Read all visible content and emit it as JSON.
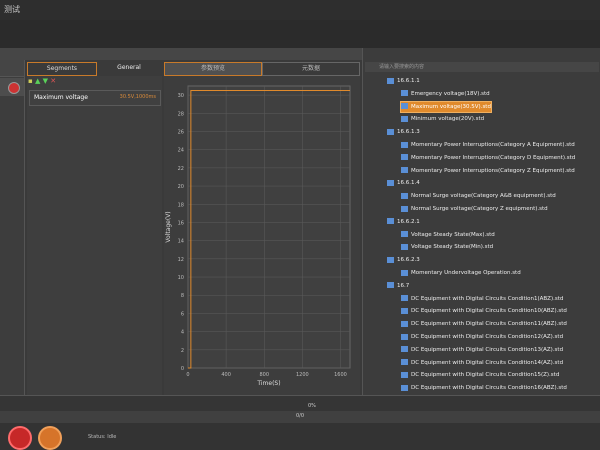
{
  "app": {
    "title": "测试"
  },
  "tabs": {
    "segments": "Segments",
    "general": "General",
    "chart_tab1": "参数预览",
    "chart_tab2": "元数据"
  },
  "segment_item": {
    "name": "Maximum voltage",
    "value": "30.5V,1000ms"
  },
  "tree": {
    "search_placeholder": "请输入要搜索的内容",
    "items": [
      {
        "label": "16.6.1.1",
        "level": 0
      },
      {
        "label": "Emergency voltage(18V).std",
        "level": 1
      },
      {
        "label": "Maximum voltage(30.5V).std",
        "level": 1,
        "selected": true
      },
      {
        "label": "Minimum voltage(20V).std",
        "level": 1
      },
      {
        "label": "16.6.1.3",
        "level": 0
      },
      {
        "label": "Momentary Power Interruptions(Category A Equipment).std",
        "level": 1
      },
      {
        "label": "Momentary Power Interruptions(Category D Equipment).std",
        "level": 1
      },
      {
        "label": "Momentary Power Interruptions(Category Z Equipment).std",
        "level": 1
      },
      {
        "label": "16.6.1.4",
        "level": 0
      },
      {
        "label": "Normal Surge voltage(Category A&B equipment).std",
        "level": 1
      },
      {
        "label": "Normal Surge voltage(Category Z equipment).std",
        "level": 1
      },
      {
        "label": "16.6.2.1",
        "level": 0
      },
      {
        "label": "Voltage Steady State(Max).std",
        "level": 1
      },
      {
        "label": "Voltage Steady State(Min).std",
        "level": 1
      },
      {
        "label": "16.6.2.3",
        "level": 0
      },
      {
        "label": "Momentary Undervoltage Operation.std",
        "level": 1
      },
      {
        "label": "16.7",
        "level": 0
      },
      {
        "label": "DC Equipment with Digital Circuits Condition1(ABZ).std",
        "level": 1
      },
      {
        "label": "DC Equipment with Digital Circuits Condition10(ABZ).std",
        "level": 1
      },
      {
        "label": "DC Equipment with Digital Circuits Condition11(ABZ).std",
        "level": 1
      },
      {
        "label": "DC Equipment with Digital Circuits Condition12(AZ).std",
        "level": 1
      },
      {
        "label": "DC Equipment with Digital Circuits Condition13(AZ).std",
        "level": 1
      },
      {
        "label": "DC Equipment with Digital Circuits Condition14(AZ).std",
        "level": 1
      },
      {
        "label": "DC Equipment with Digital Circuits Condition15(Z).std",
        "level": 1
      },
      {
        "label": "DC Equipment with Digital Circuits Condition16(ABZ).std",
        "level": 1
      },
      {
        "label": "DC Equipment with Digital Circuits Condition17(ABZ).std",
        "level": 1
      }
    ]
  },
  "chart_data": {
    "type": "line",
    "xlabel": "Time(S)",
    "ylabel": "Voltage(V)",
    "xlim": [
      0,
      1700
    ],
    "ylim": [
      0,
      31
    ],
    "xticks": [
      0,
      400,
      800,
      1200,
      1600
    ],
    "yticks": [
      0,
      2,
      4,
      6,
      8,
      10,
      12,
      14,
      16,
      18,
      20,
      22,
      24,
      26,
      28,
      30
    ],
    "series": [
      {
        "x": [
          0,
          30,
          30,
          1700
        ],
        "y": [
          0,
          0,
          30.5,
          30.5
        ],
        "color": "#e08a2c"
      }
    ]
  },
  "progress": {
    "value": 0,
    "label": "0%"
  },
  "bottom_label": "0/0",
  "status": {
    "label": "Status:",
    "value": "Idle"
  },
  "colors": {
    "accent": "#e08a2c",
    "tree_icon": "#5a8fd6"
  }
}
